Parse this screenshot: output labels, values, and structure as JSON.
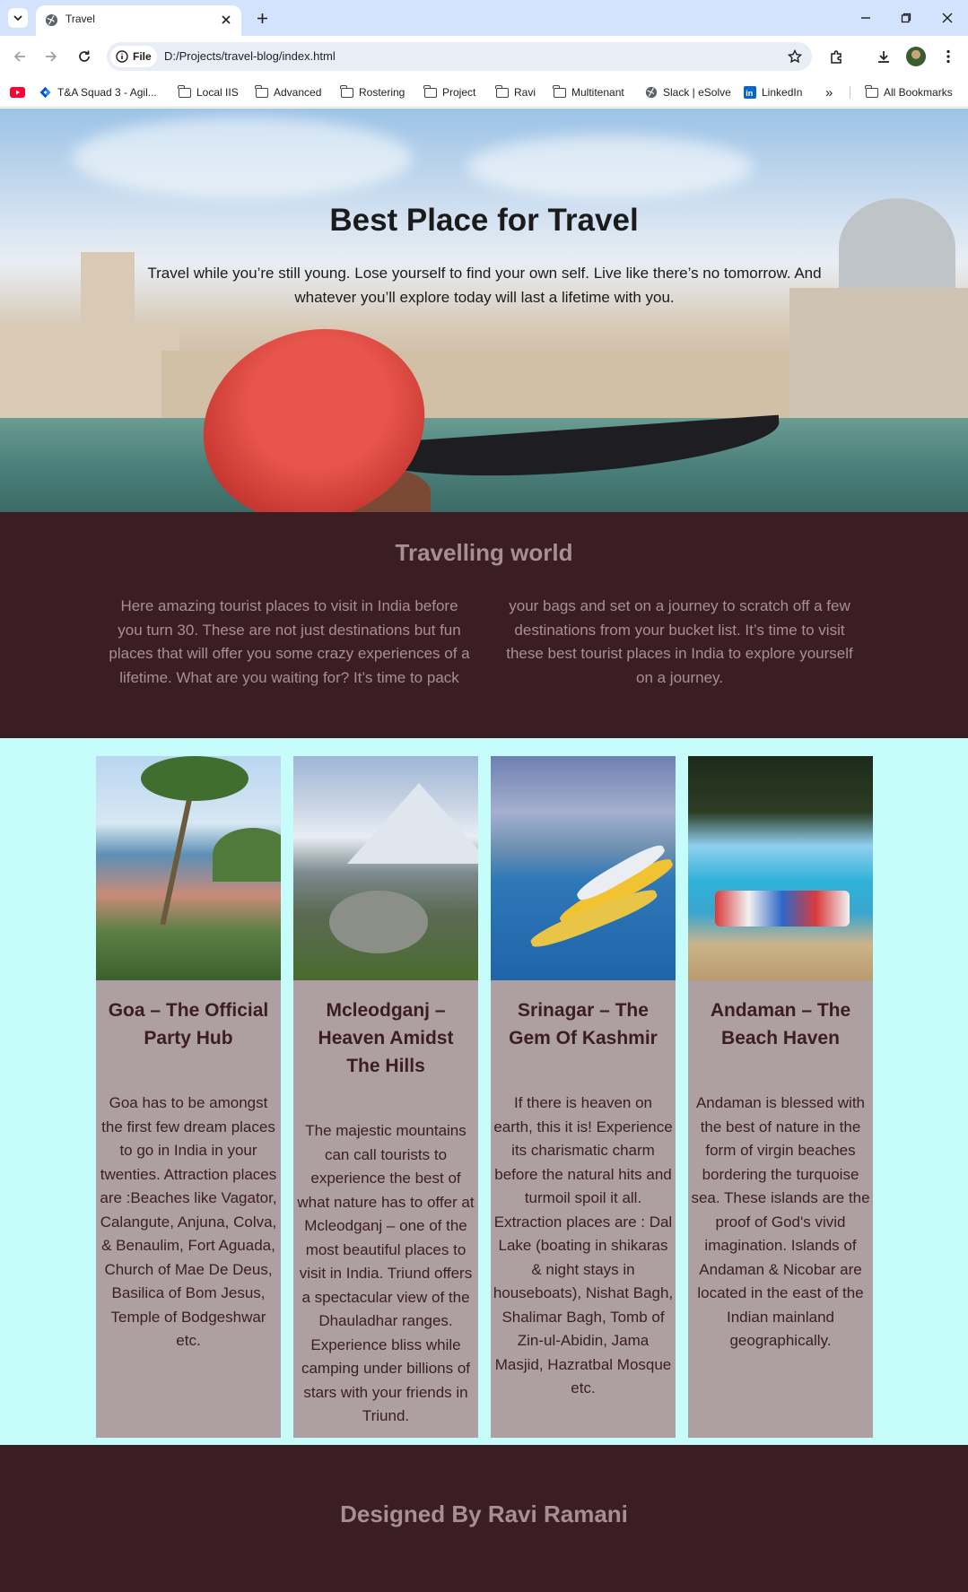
{
  "browser": {
    "tab_title": "Travel",
    "site_chip": "File",
    "url": "D:/Projects/travel-blog/index.html",
    "bookmarks": [
      {
        "label": "",
        "icon": "youtube-icon"
      },
      {
        "label": "T&A Squad 3 - Agil...",
        "icon": "jira-icon"
      },
      {
        "label": "Local IIS",
        "icon": "folder-icon"
      },
      {
        "label": "Advanced",
        "icon": "folder-icon"
      },
      {
        "label": "Rostering",
        "icon": "folder-icon"
      },
      {
        "label": "Project",
        "icon": "folder-icon"
      },
      {
        "label": "Ravi",
        "icon": "folder-icon"
      },
      {
        "label": "Multitenant",
        "icon": "folder-icon"
      },
      {
        "label": "Slack | eSolve",
        "icon": "globe-icon"
      },
      {
        "label": "LinkedIn",
        "icon": "linkedin-icon"
      }
    ],
    "overflow_label": "»",
    "all_bookmarks": "All Bookmarks"
  },
  "hero": {
    "title": "Best Place for Travel",
    "text": "Travel while you’re still young. Lose yourself to find your own self. Live like there’s no tomorrow. And whatever you’ll explore today will last a lifetime with you."
  },
  "intro": {
    "title": "Travelling world",
    "text": "Here amazing tourist places to visit in India before you turn 30. These are not just destinations but fun places that will offer you some crazy experiences of a lifetime. What are you waiting for? It’s time to pack your bags and set on a journey to scratch off a few destinations from your bucket list. It’s time to visit these best tourist places in India to explore yourself on a journey."
  },
  "cards": [
    {
      "title": "Goa – The Official Party Hub",
      "text": "Goa has to be amongst the first few dream places to go in India in your twenties. Attraction places are :Beaches like Vagator, Calangute, Anjuna, Colva, & Benaulim, Fort Aguada, Church of Mae De Deus, Basilica of Bom Jesus, Temple of Bodgeshwar etc."
    },
    {
      "title": "Mcleodganj – Heaven Amidst The Hills",
      "text": "The majestic mountains can call tourists to experience the best of what nature has to offer at Mcleodganj – one of the most beautiful places to visit in India. Triund offers a spectacular view of the Dhauladhar ranges. Experience bliss while camping under billions of stars with your friends in Triund."
    },
    {
      "title": "Srinagar – The Gem Of Kashmir",
      "text": "If there is heaven on earth, this it is! Experience its charismatic charm before the natural hits and turmoil spoil it all. Extraction places are : Dal Lake (boating in shikaras & night stays in houseboats), Nishat Bagh, Shalimar Bagh, Tomb of Zin-ul-Abidin, Jama Masjid, Hazratbal Mosque etc."
    },
    {
      "title": "Andaman – The Beach Haven",
      "text": "Andaman is blessed with the best of nature in the form of virgin beaches bordering the turquoise sea. These islands are the proof of God's vivid imagination. Islands of Andaman & Nicobar are located in the east of the Indian mainland geographically."
    }
  ],
  "footer": {
    "text": "Designed By Ravi Ramani"
  },
  "colors": {
    "dark_maroon": "#3b1e24",
    "muted_text": "#a88f93",
    "card_bg": "#ae9fa2",
    "cards_section_bg": "#c6fcfa",
    "tabbar_bg": "#d3e3fd"
  }
}
